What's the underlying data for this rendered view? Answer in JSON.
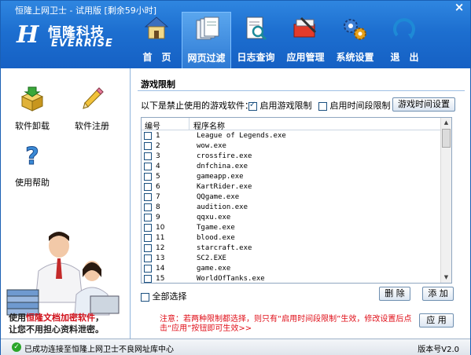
{
  "window": {
    "title": "恒隆上网卫士 - 试用版 [剩余59小时]",
    "close_glyph": "×"
  },
  "logo": {
    "mark": "H",
    "name_cn": "恒隆科技",
    "name_en": "EVERRISE"
  },
  "nav": [
    {
      "label": "首　页",
      "icon": "home-icon"
    },
    {
      "label": "网页过滤",
      "icon": "pages-icon",
      "active": true
    },
    {
      "label": "日志查询",
      "icon": "log-search-icon"
    },
    {
      "label": "应用管理",
      "icon": "app-manage-icon"
    },
    {
      "label": "系统设置",
      "icon": "gears-icon"
    },
    {
      "label": "退　出",
      "icon": "exit-icon"
    }
  ],
  "sidebar": {
    "uninstall": "软件卸载",
    "register": "软件注册",
    "help": "使用帮助",
    "ad_line1_prefix": "使用",
    "ad_line1_highlight": "恒隆文档加密软件",
    "ad_line1_suffix": "，",
    "ad_line2": "让您不用担心资料泄密。"
  },
  "main": {
    "section_title": "游戏限制",
    "list_label": "以下是禁止使用的游戏软件：",
    "enable_game_limit": "启用游戏限制",
    "enable_time_limit": "启用时间段限制",
    "game_time_settings": "游戏时间设置",
    "col_num": "编号",
    "col_name": "程序名称",
    "rows": [
      {
        "num": "1",
        "name": "League of Legends.exe"
      },
      {
        "num": "2",
        "name": "wow.exe"
      },
      {
        "num": "3",
        "name": "crossfire.exe"
      },
      {
        "num": "4",
        "name": "dnfchina.exe"
      },
      {
        "num": "5",
        "name": "gameapp.exe"
      },
      {
        "num": "6",
        "name": "KartRider.exe"
      },
      {
        "num": "7",
        "name": "QQgame.exe"
      },
      {
        "num": "8",
        "name": "audition.exe"
      },
      {
        "num": "9",
        "name": "qqxu.exe"
      },
      {
        "num": "10",
        "name": "Tgame.exe"
      },
      {
        "num": "11",
        "name": "blood.exe"
      },
      {
        "num": "12",
        "name": "starcraft.exe"
      },
      {
        "num": "13",
        "name": "SC2.EXE"
      },
      {
        "num": "14",
        "name": "game.exe"
      },
      {
        "num": "15",
        "name": "WorldOfTanks.exe"
      }
    ],
    "select_all": "全部选择",
    "delete": "删 除",
    "add": "添 加",
    "note": "注意：若两种限制都选择，则只有“启用时间段限制”生效，修改设置后点击“应用”按钮即可生效>>",
    "apply": "应 用"
  },
  "status": {
    "text": "已成功连接至恒隆上网卫士不良网址库中心",
    "version": "版本号V2.0"
  },
  "colors": {
    "header_blue": "#1d6fd0",
    "note_red": "#e0101a",
    "ad_red": "#d0101a"
  }
}
